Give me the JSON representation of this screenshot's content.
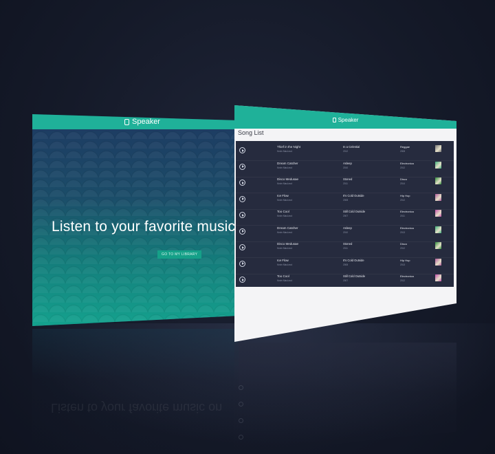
{
  "left_window": {
    "app_title": "Speaker",
    "hero_text": "Listen to your favorite music on",
    "cta_label": "GO TO MY LIBRARY",
    "accent": "#1fb199"
  },
  "right_window": {
    "app_title": "Speaker",
    "section_title": "Song List",
    "songs": [
      {
        "title": "Thief in the Night",
        "artist": "Kevin MacLeod",
        "album": "In a Celestial",
        "year": "2012",
        "genre": "Reggae",
        "num": "2008",
        "thumb": "#777777"
      },
      {
        "title": "Dream Catcher",
        "artist": "Kevin MacLeod",
        "album": "Asleep",
        "year": "2010",
        "genre": "Electronica",
        "num": "2012",
        "thumb": "#3fb07a"
      },
      {
        "title": "Disco Medusae",
        "artist": "Kevin MacLeod",
        "album": "Stoned",
        "year": "2011",
        "genre": "Disco",
        "num": "2014",
        "thumb": "#2f8d3a"
      },
      {
        "title": "Ice Flow",
        "artist": "Kevin MacLeod",
        "album": "It's Cold Outside",
        "year": "2008",
        "genre": "Hip Hop",
        "num": "2012",
        "thumb": "#b15a9a"
      },
      {
        "title": "Too Cool",
        "artist": "Kevin MacLeod",
        "album": "Still Cold Outside",
        "year": "2007",
        "genre": "Electronica",
        "num": "2011",
        "thumb": "#c34fa8"
      },
      {
        "title": "Dream Catcher",
        "artist": "Kevin MacLeod",
        "album": "Asleep",
        "year": "2010",
        "genre": "Electronica",
        "num": "2013",
        "thumb": "#3fb07a"
      },
      {
        "title": "Disco Medusae",
        "artist": "Kevin MacLeod",
        "album": "Stoned",
        "year": "2011",
        "genre": "Disco",
        "num": "2012",
        "thumb": "#2f8d3a"
      },
      {
        "title": "Ice Flow",
        "artist": "Kevin MacLeod",
        "album": "It's Cold Outside",
        "year": "2008",
        "genre": "Hip Hop",
        "num": "2013",
        "thumb": "#b15a9a"
      },
      {
        "title": "Too Cool",
        "artist": "Kevin MacLeod",
        "album": "Still Cold Outside",
        "year": "2007",
        "genre": "Electronica",
        "num": "2012",
        "thumb": "#c34fa8"
      }
    ]
  }
}
